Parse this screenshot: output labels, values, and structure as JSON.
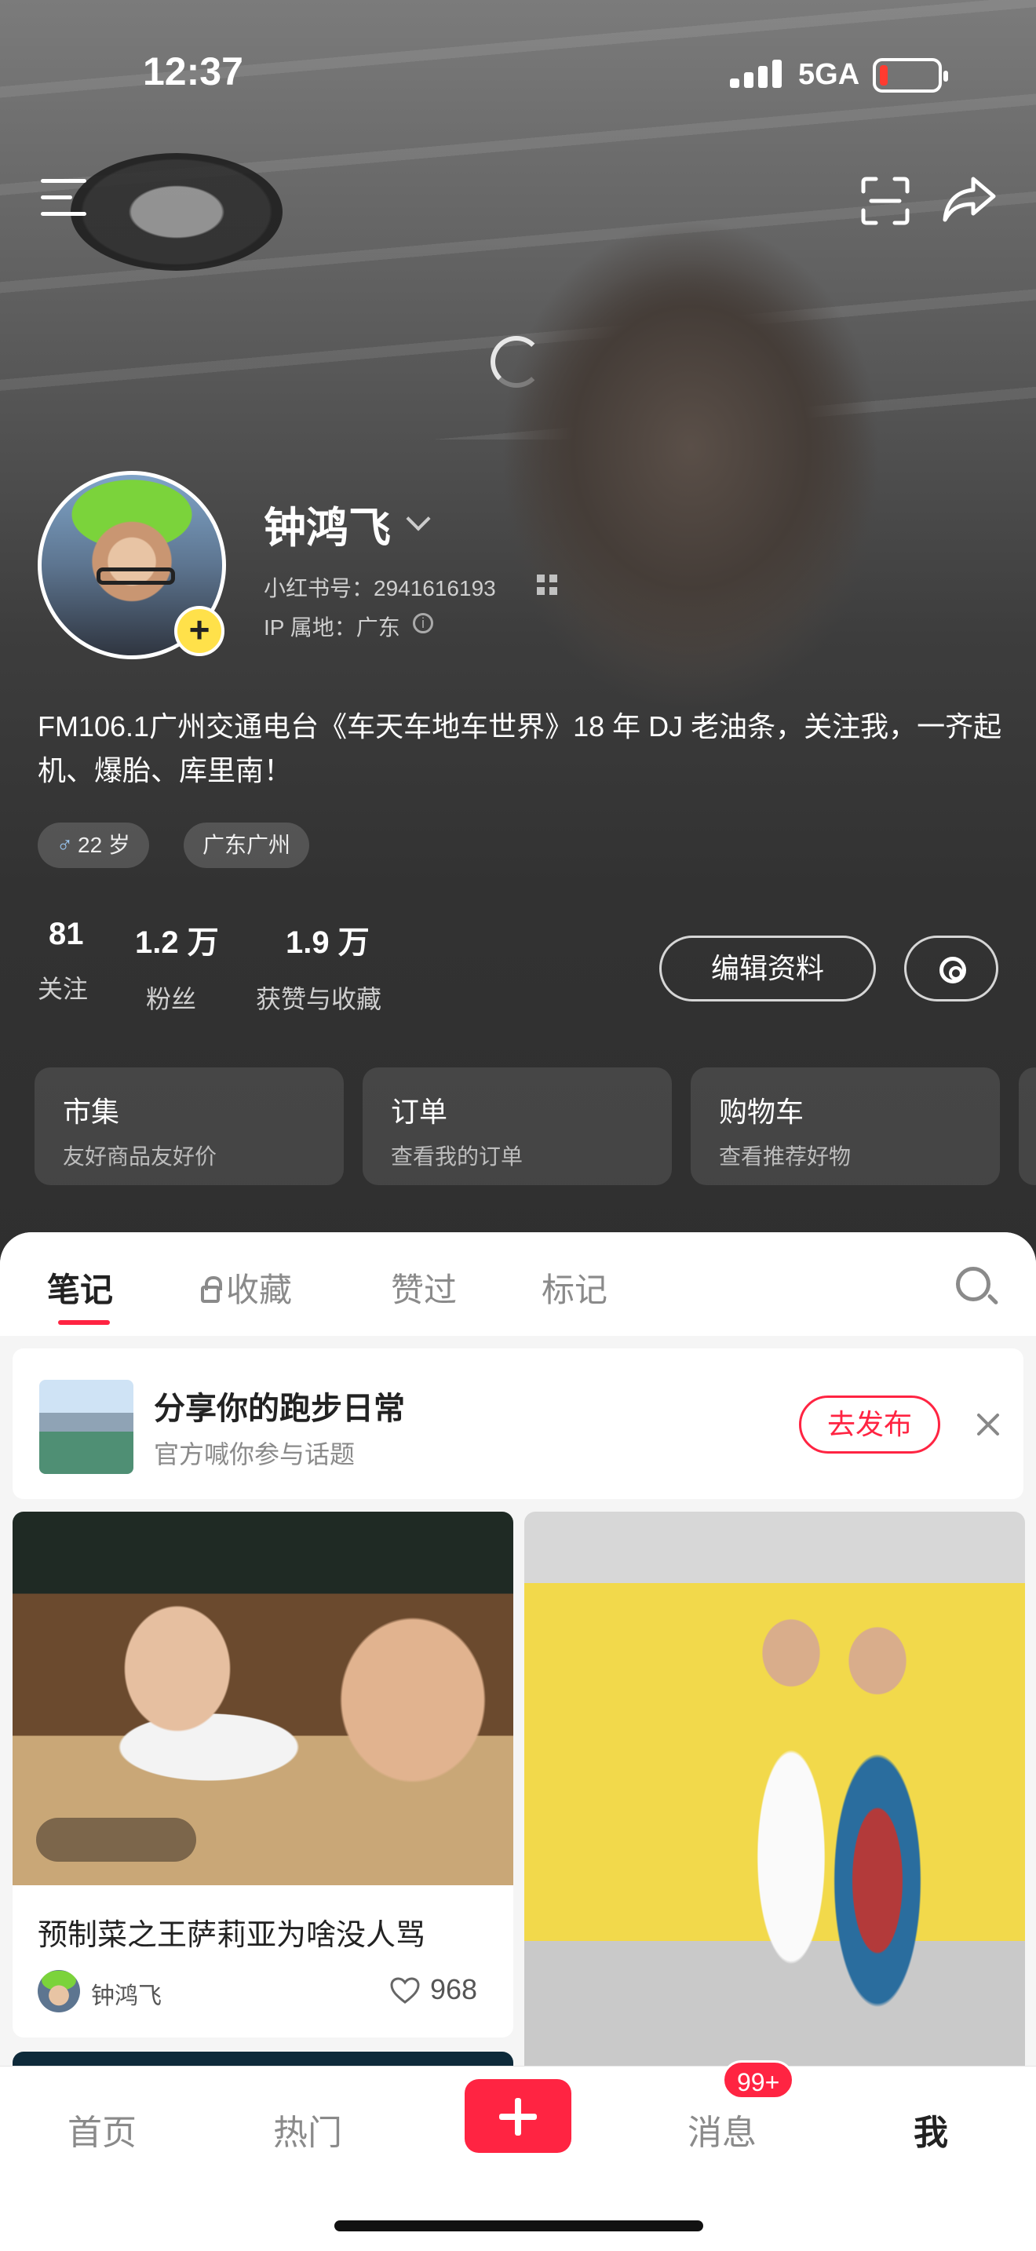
{
  "status_bar": {
    "time": "12:37",
    "network": "5GA"
  },
  "profile": {
    "name": "钟鸿飞",
    "id_line": "小红书号：2941616193",
    "ip_line": "IP 属地：广东",
    "bio": "FM106.1广州交通电台《车天车地车世界》18 年 DJ 老油条，关注我，一齐起机、爆胎、库里南！",
    "tags": [
      {
        "label": "22 岁",
        "icon": "male-icon"
      },
      {
        "label": "广东广州"
      }
    ],
    "stats": [
      {
        "num": "81",
        "label": "关注"
      },
      {
        "num": "1.2 万",
        "label": "粉丝"
      },
      {
        "num": "1.9 万",
        "label": "获赞与收藏"
      }
    ],
    "edit_button": "编辑资料"
  },
  "cards": [
    {
      "title": "市集",
      "sub": "友好商品友好价"
    },
    {
      "title": "订单",
      "sub": "查看我的订单"
    },
    {
      "title": "购物车",
      "sub": "查看推荐好物"
    }
  ],
  "tabs": {
    "notes": "笔记",
    "collect": "收藏",
    "liked": "赞过",
    "marked": "标记"
  },
  "banner": {
    "title": "分享你的跑步日常",
    "sub": "官方喊你参与话题",
    "button": "去发布"
  },
  "notes": [
    {
      "title": "预制菜之王萨莉亚为啥没人骂",
      "author": "钟鸿飞",
      "likes": "968"
    }
  ],
  "bottom_nav": {
    "home": "首页",
    "hot": "热门",
    "messages": "消息",
    "messages_badge": "99+",
    "me": "我"
  },
  "colors": {
    "accent": "#ff2442",
    "add_badge": "#ffe14a"
  }
}
